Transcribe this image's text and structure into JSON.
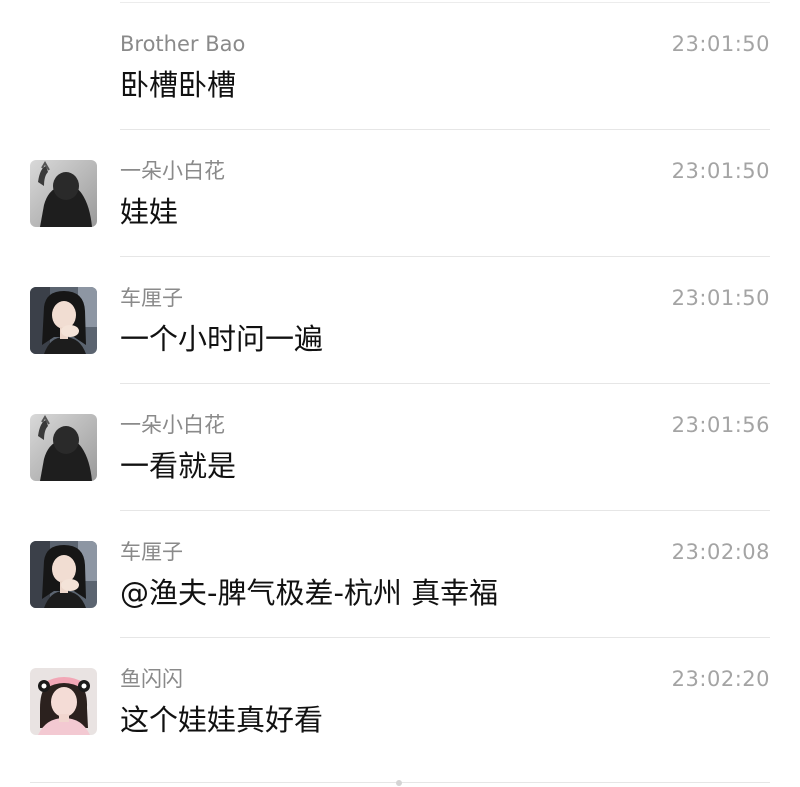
{
  "messages": [
    {
      "sender": "Brother Bao",
      "time": "23:01:50",
      "text": "卧槽卧槽",
      "avatar": "none"
    },
    {
      "sender": "一朵小白花",
      "time": "23:01:50",
      "text": "娃娃",
      "avatar": "dark-hooded-figure"
    },
    {
      "sender": "车厘子",
      "time": "23:01:50",
      "text": "一个小时问一遍",
      "avatar": "woman-portrait"
    },
    {
      "sender": "一朵小白花",
      "time": "23:01:56",
      "text": "一看就是",
      "avatar": "dark-hooded-figure"
    },
    {
      "sender": "车厘子",
      "time": "23:02:08",
      "text": "@渔夫-脾气极差-杭州 真幸福",
      "avatar": "woman-portrait"
    },
    {
      "sender": "鱼闪闪",
      "time": "23:02:20",
      "text": "这个娃娃真好看",
      "avatar": "girl-pink-headband"
    }
  ],
  "colors": {
    "sender": "#8a8a8a",
    "time": "#a4a4a4",
    "text": "#111111",
    "divider": "#e6e6e6"
  }
}
